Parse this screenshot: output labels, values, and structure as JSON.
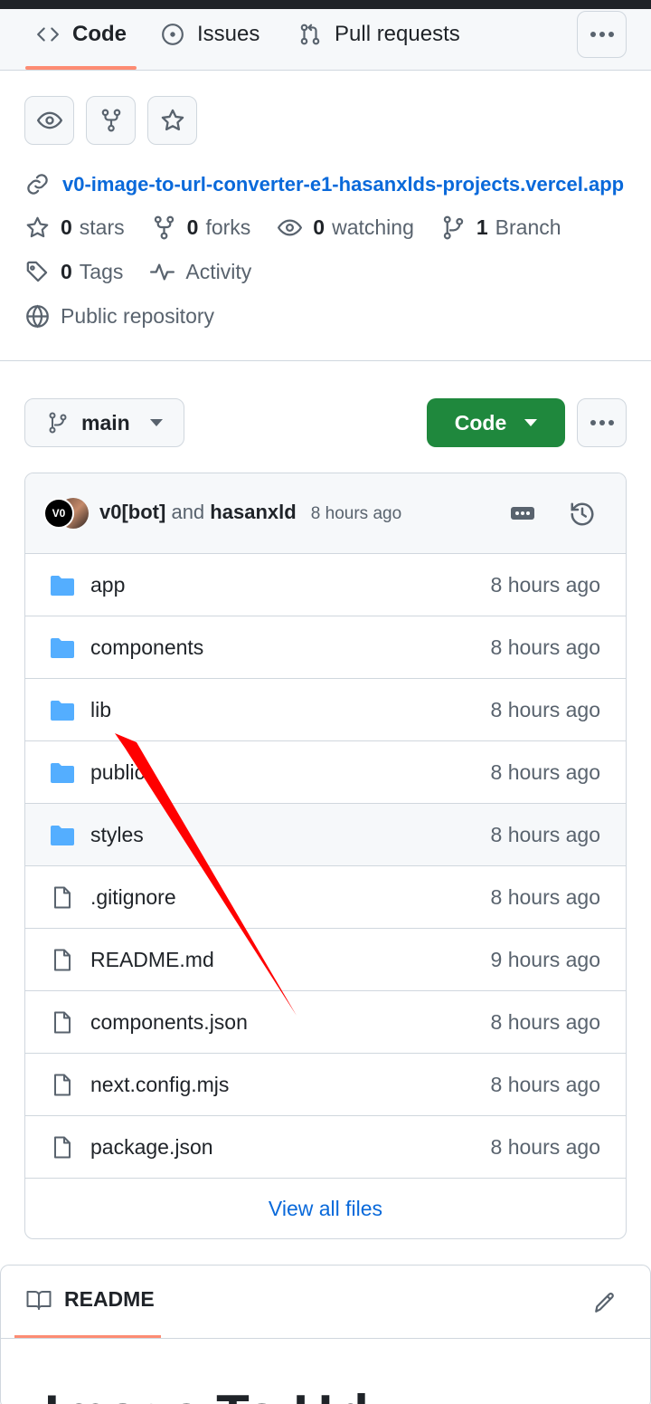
{
  "tabs": [
    {
      "label": "Code",
      "icon": "code-icon"
    },
    {
      "label": "Issues",
      "icon": "issue-icon"
    },
    {
      "label": "Pull requests",
      "icon": "pull-request-icon"
    }
  ],
  "repo": {
    "url": "v0-image-to-url-converter-e1-hasanxlds-projects.vercel.app",
    "stars_count": "0",
    "stars_label": "stars",
    "forks_count": "0",
    "forks_label": "forks",
    "watching_count": "0",
    "watching_label": "watching",
    "branch_count": "1",
    "branch_label": "Branch",
    "tags_count": "0",
    "tags_label": "Tags",
    "activity_label": "Activity",
    "visibility": "Public repository"
  },
  "toolbar": {
    "branch": "main",
    "code_button": "Code"
  },
  "commit": {
    "author1": "v0[bot]",
    "joiner": "and",
    "author2": "hasanxld",
    "time": "8 hours ago",
    "avatar1_text": "V0"
  },
  "files": [
    {
      "name": "app",
      "type": "folder",
      "time": "8 hours ago"
    },
    {
      "name": "components",
      "type": "folder",
      "time": "8 hours ago"
    },
    {
      "name": "lib",
      "type": "folder",
      "time": "8 hours ago"
    },
    {
      "name": "public",
      "type": "folder",
      "time": "8 hours ago"
    },
    {
      "name": "styles",
      "type": "folder",
      "time": "8 hours ago"
    },
    {
      "name": ".gitignore",
      "type": "file",
      "time": "8 hours ago"
    },
    {
      "name": "README.md",
      "type": "file",
      "time": "9 hours ago"
    },
    {
      "name": "components.json",
      "type": "file",
      "time": "8 hours ago"
    },
    {
      "name": "next.config.mjs",
      "type": "file",
      "time": "8 hours ago"
    },
    {
      "name": "package.json",
      "type": "file",
      "time": "8 hours ago"
    }
  ],
  "view_all": "View all files",
  "readme": {
    "tab_label": "README",
    "heading": "Image To Url"
  },
  "colors": {
    "accent": "#0969da",
    "code_button": "#1f883d",
    "tab_underline": "#fd8c73",
    "folder": "#54aeff",
    "annotation_arrow": "#ff0000"
  }
}
